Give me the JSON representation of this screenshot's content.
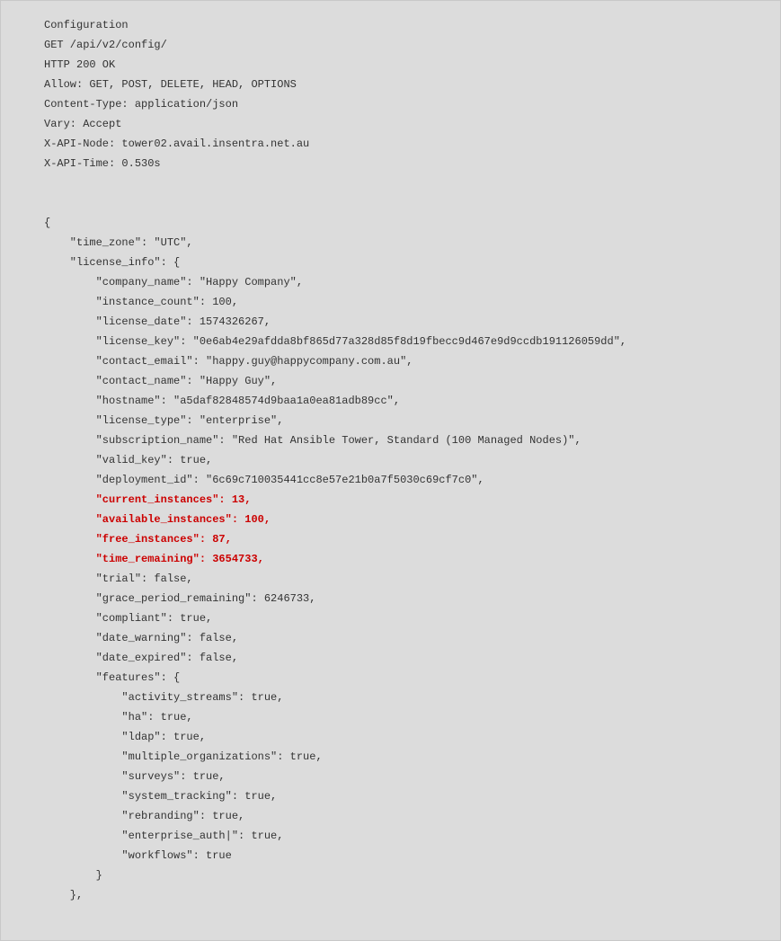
{
  "header": {
    "l1": "Configuration",
    "l2": "GET /api/v2/config/",
    "l3": "HTTP 200 OK",
    "l4": "Allow: GET, POST, DELETE, HEAD, OPTIONS",
    "l5": "Content-Type: application/json",
    "l6": "Vary: Accept",
    "l7": "X-API-Node: tower02.avail.insentra.net.au",
    "l8": "X-API-Time: 0.530s"
  },
  "body": {
    "open": "{",
    "l1": "    \"time_zone\": \"UTC\",",
    "l2": "    \"license_info\": {",
    "l3": "        \"company_name\": \"Happy Company\",",
    "l4": "        \"instance_count\": 100,",
    "l5": "        \"license_date\": 1574326267,",
    "l6": "        \"license_key\": \"0e6ab4e29afdda8bf865d77a328d85f8d19fbecc9d467e9d9ccdb191126059dd\",",
    "l7": "        \"contact_email\": \"happy.guy@happycompany.com.au\",",
    "l8": "        \"contact_name\": \"Happy Guy\",",
    "l9": "        \"hostname\": \"a5daf82848574d9baa1a0ea81adb89cc\",",
    "l10": "        \"license_type\": \"enterprise\",",
    "l11": "        \"subscription_name\": \"Red Hat Ansible Tower, Standard (100 Managed Nodes)\",",
    "l12": "        \"valid_key\": true,",
    "l13": "        \"deployment_id\": \"6c69c710035441cc8e57e21b0a7f5030c69cf7c0\",",
    "h1": "        \"current_instances\": 13,",
    "h2": "        \"available_instances\": 100,",
    "h3": "        \"free_instances\": 87,",
    "h4": "        \"time_remaining\": 3654733,",
    "l14": "        \"trial\": false,",
    "l15": "        \"grace_period_remaining\": 6246733,",
    "l16": "        \"compliant\": true,",
    "l17": "        \"date_warning\": false,",
    "l18": "        \"date_expired\": false,",
    "l19": "        \"features\": {",
    "l20": "            \"activity_streams\": true,",
    "l21": "            \"ha\": true,",
    "l22": "            \"ldap\": true,",
    "l23": "            \"multiple_organizations\": true,",
    "l24": "            \"surveys\": true,",
    "l25": "            \"system_tracking\": true,",
    "l26": "            \"rebranding\": true,",
    "l27": "            \"enterprise_auth|\": true,",
    "l28": "            \"workflows\": true",
    "l29": "        }",
    "l30": "    },"
  }
}
